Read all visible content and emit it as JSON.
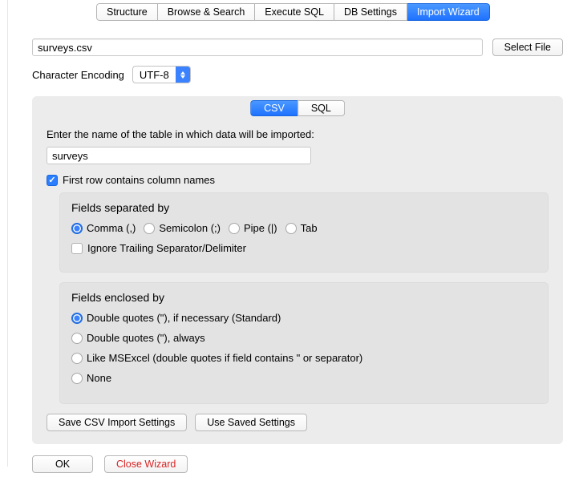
{
  "tabs": {
    "structure": "Structure",
    "browse": "Browse & Search",
    "execute": "Execute SQL",
    "settings": "DB Settings",
    "import": "Import Wizard"
  },
  "file": {
    "value": "surveys.csv",
    "select_button": "Select File"
  },
  "encoding": {
    "label": "Character Encoding",
    "value": "UTF-8"
  },
  "format_tabs": {
    "csv": "CSV",
    "sql": "SQL"
  },
  "table": {
    "prompt": "Enter the name of the table in which data will be imported:",
    "value": "surveys"
  },
  "first_row": "First row contains column names",
  "separator": {
    "title": "Fields separated by",
    "comma": "Comma (,)",
    "semicolon": "Semicolon (;)",
    "pipe": "Pipe (|)",
    "tab": "Tab",
    "ignore": "Ignore Trailing Separator/Delimiter"
  },
  "enclosure": {
    "title": "Fields enclosed by",
    "opt1": "Double quotes (\"), if necessary (Standard)",
    "opt2": "Double quotes (\"), always",
    "opt3": "Like MSExcel (double quotes if field contains \" or separator)",
    "opt4": "None"
  },
  "buttons": {
    "save_settings": "Save CSV Import Settings",
    "use_saved": "Use Saved Settings",
    "ok": "OK",
    "close": "Close Wizard"
  }
}
